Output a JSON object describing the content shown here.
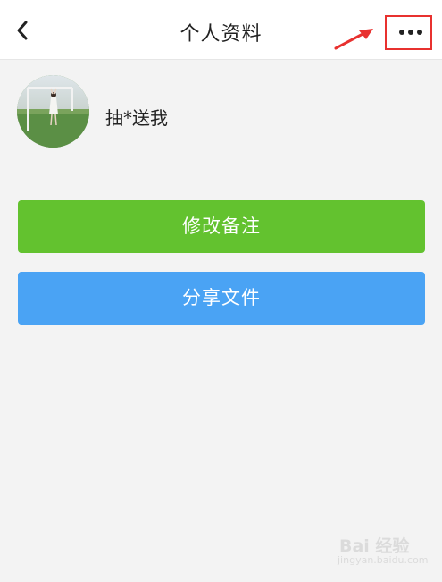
{
  "header": {
    "title": "个人资料",
    "back_icon": "chevron-left-icon",
    "more_icon": "more-horizontal-icon"
  },
  "profile": {
    "username": "抽*送我"
  },
  "actions": {
    "edit_remark_label": "修改备注",
    "share_file_label": "分享文件"
  },
  "colors": {
    "green_button": "#63c22f",
    "blue_button": "#4aa3f4",
    "annotation_red": "#e8312f",
    "background": "#f3f3f3"
  },
  "watermark": {
    "main": "Bai 经验",
    "sub": "jingyan.baidu.com"
  }
}
